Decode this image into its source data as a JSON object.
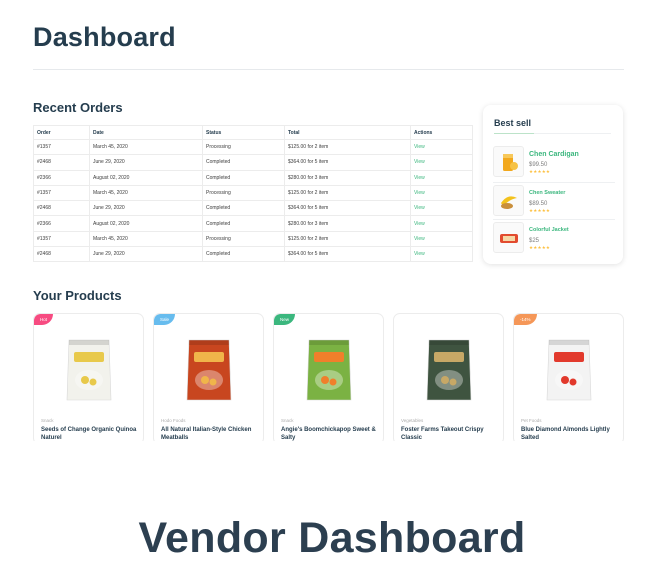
{
  "page": {
    "title": "Dashboard",
    "footer_title": "Vendor Dashboard"
  },
  "recent_orders": {
    "title": "Recent Orders",
    "columns": [
      "Order",
      "Date",
      "Status",
      "Total",
      "Actions"
    ],
    "rows": [
      [
        "#1357",
        "March 45, 2020",
        "Processing",
        "$125.00 for 2 item",
        "View"
      ],
      [
        "#2468",
        "June 29, 2020",
        "Completed",
        "$364.00 for 5 item",
        "View"
      ],
      [
        "#2366",
        "August 02, 2020",
        "Completed",
        "$280.00 for 3 item",
        "View"
      ],
      [
        "#1357",
        "March 45, 2020",
        "Processing",
        "$125.00 for 2 item",
        "View"
      ],
      [
        "#2468",
        "June 29, 2020",
        "Completed",
        "$364.00 for 5 item",
        "View"
      ],
      [
        "#2366",
        "August 02, 2020",
        "Completed",
        "$280.00 for 3 item",
        "View"
      ],
      [
        "#1357",
        "March 45, 2020",
        "Processing",
        "$125.00 for 2 item",
        "View"
      ],
      [
        "#2468",
        "June 29, 2020",
        "Completed",
        "$364.00 for 5 item",
        "View"
      ]
    ]
  },
  "best_sell": {
    "title": "Best sell",
    "items": [
      {
        "name": "Chen Cardigan",
        "price": "$99.50",
        "rating": 4
      },
      {
        "name": "Chen Sweater",
        "price": "$89.50",
        "rating": 4
      },
      {
        "name": "Colorful Jacket",
        "price": "$25",
        "rating": 4
      }
    ]
  },
  "products": {
    "title": "Your Products",
    "items": [
      {
        "badge": "Hot",
        "badge_color": "#f74b81",
        "category": "Snack",
        "name": "Seeds of Change Organic Quinoa Naturel",
        "pack_color": "#f2f2ec",
        "accent": "#e8c94b"
      },
      {
        "badge": "Sale",
        "badge_color": "#67bcee",
        "category": "Hodo Foods",
        "name": "All Natural Italian-Style Chicken Meatballs",
        "pack_color": "#c8461f",
        "accent": "#f0b54a"
      },
      {
        "badge": "New",
        "badge_color": "#3bb77e",
        "category": "Snack",
        "name": "Angie's Boomchickapop Sweet & Salty",
        "pack_color": "#7bb243",
        "accent": "#f07f2b"
      },
      {
        "badge": "",
        "badge_color": "",
        "category": "Vegetables",
        "name": "Foster Farms Takeout Crispy Classic",
        "pack_color": "#3f5440",
        "accent": "#c7a866"
      },
      {
        "badge": "-14%",
        "badge_color": "#f59758",
        "category": "Pet Foods",
        "name": "Blue Diamond Almonds Lightly Salted",
        "pack_color": "#f3f3f3",
        "accent": "#e23a2d"
      }
    ]
  }
}
